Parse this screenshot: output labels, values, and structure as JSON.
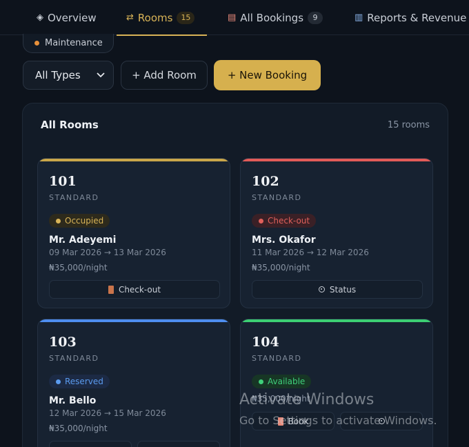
{
  "tabs": [
    {
      "icon": "◈",
      "label": "Overview",
      "count": null
    },
    {
      "icon": "⇄",
      "label": "Rooms",
      "count": "15"
    },
    {
      "icon": "▤",
      "label": "All Bookings",
      "count": "9"
    },
    {
      "icon": "▥",
      "label": "Reports & Revenue",
      "count": null
    }
  ],
  "filter_chip": {
    "label": "Maintenance",
    "dot_color": "#e8903a"
  },
  "controls": {
    "type_select": "All Types",
    "add_room": "+ Add Room",
    "new_booking": "+ New Booking"
  },
  "panel": {
    "title": "All Rooms",
    "count": "15 rooms"
  },
  "rooms": [
    {
      "number": "101",
      "type": "STANDARD",
      "status": "Occupied",
      "status_color": "#d9b457",
      "guest": "Mr. Adeyemi",
      "dates": "09 Mar 2026 → 13 Mar 2026",
      "price": "₦35,000/night",
      "action": "Check-out",
      "action_icon": "door-icon",
      "bar_color": "#c9a64a"
    },
    {
      "number": "102",
      "type": "STANDARD",
      "status": "Check-out",
      "status_color": "#e0605b",
      "guest": "Mrs. Okafor",
      "dates": "11 Mar 2026 → 12 Mar 2026",
      "price": "₦35,000/night",
      "action": "Status",
      "action_icon": "status-icon",
      "bar_color": "#e25b58"
    },
    {
      "number": "103",
      "type": "STANDARD",
      "status": "Reserved",
      "status_color": "#5b9cf0",
      "guest": "Mr. Bello",
      "dates": "12 Mar 2026 → 15 Mar 2026",
      "price": "₦35,000/night",
      "bar_color": "#4e8ef0"
    },
    {
      "number": "104",
      "type": "STANDARD",
      "status": "Available",
      "status_color": "#3fcf7a",
      "price": "₦35,000/night",
      "action": "Book",
      "action2": "",
      "bar_color": "#3ccf73"
    }
  ],
  "watermark": {
    "line1": "Activate Windows",
    "line2": "Go to Settings to activate Windows."
  }
}
